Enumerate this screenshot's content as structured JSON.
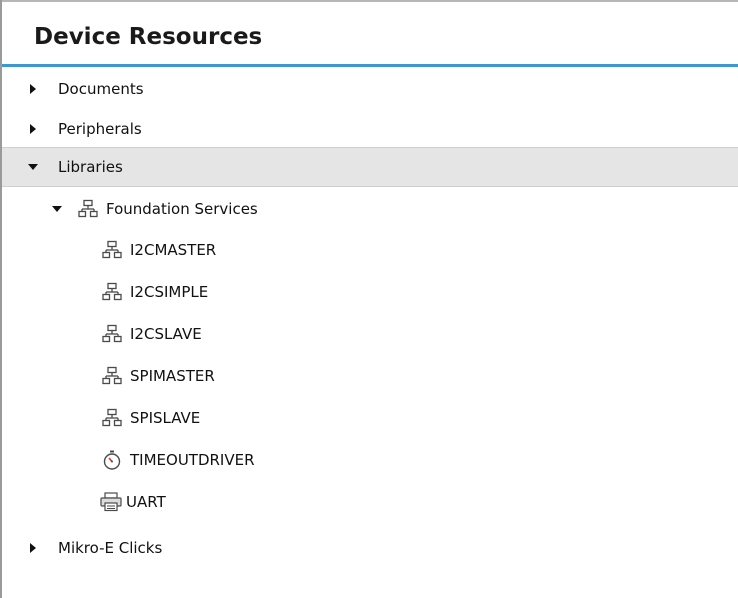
{
  "panel": {
    "title": "Device Resources"
  },
  "tree": {
    "documents": {
      "label": "Documents",
      "expander": "collapsed"
    },
    "peripherals": {
      "label": "Peripherals",
      "expander": "collapsed"
    },
    "libraries": {
      "label": "Libraries",
      "expander": "expanded",
      "selected": true,
      "children": {
        "foundation_services": {
          "label": "Foundation Services",
          "icon": "network-icon",
          "expander": "expanded",
          "children": [
            {
              "label": "I2CMASTER",
              "icon": "network-icon"
            },
            {
              "label": "I2CSIMPLE",
              "icon": "network-icon"
            },
            {
              "label": "I2CSLAVE",
              "icon": "network-icon"
            },
            {
              "label": "SPIMASTER",
              "icon": "network-icon"
            },
            {
              "label": "SPISLAVE",
              "icon": "network-icon"
            },
            {
              "label": "TIMEOUTDRIVER",
              "icon": "stopwatch-icon"
            },
            {
              "label": "UART",
              "icon": "printer-icon"
            }
          ]
        }
      }
    },
    "mikroe_clicks": {
      "label": "Mikro-E Clicks",
      "expander": "collapsed"
    }
  },
  "colors": {
    "accent_rule": "#3c97d3",
    "selected_row": "#e5e5e5",
    "icon_stroke": "#4a4a4a"
  }
}
